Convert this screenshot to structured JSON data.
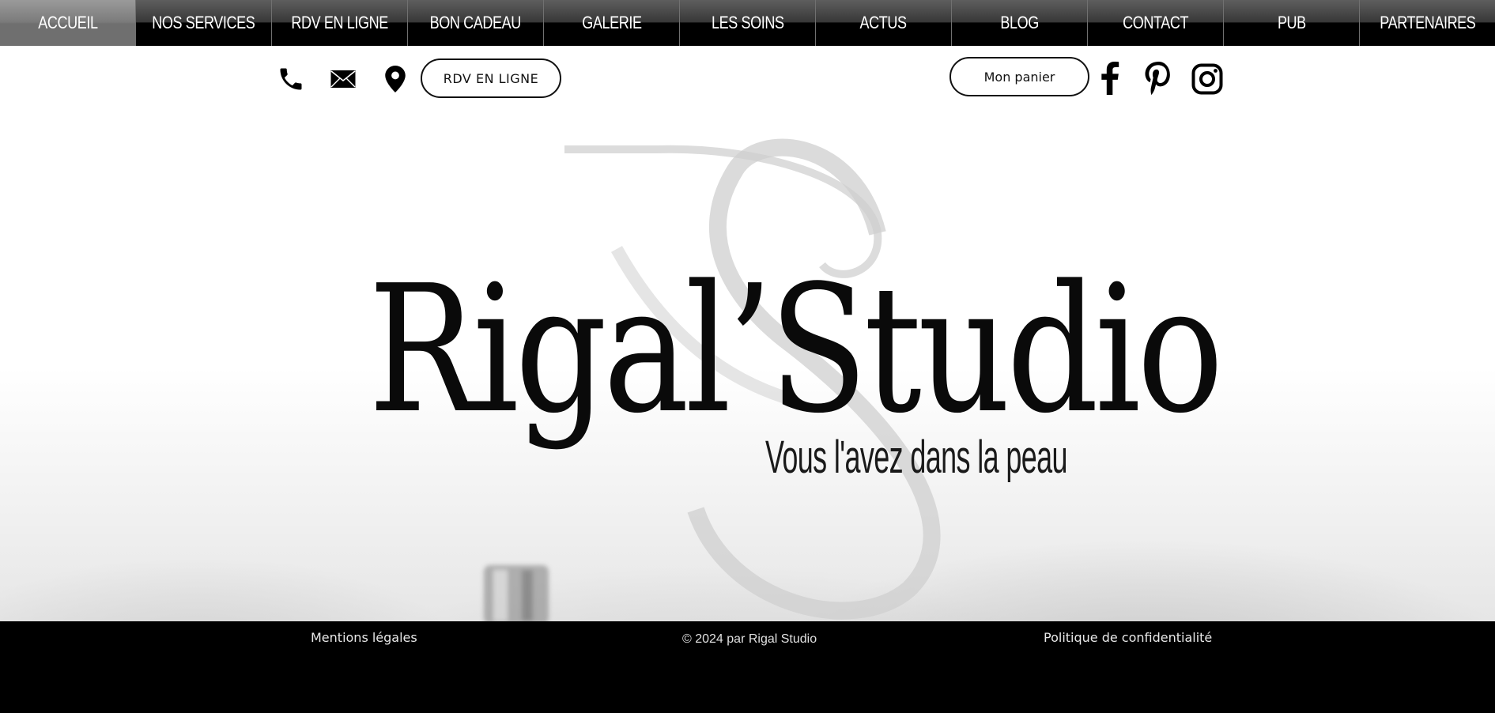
{
  "nav": {
    "items": [
      {
        "label": "ACCUEIL",
        "active": true
      },
      {
        "label": "NOS SERVICES"
      },
      {
        "label": "RDV EN LIGNE"
      },
      {
        "label": "BON CADEAU"
      },
      {
        "label": "GALERIE"
      },
      {
        "label": "LES SOINS"
      },
      {
        "label": "ACTUS"
      },
      {
        "label": "BLOG"
      },
      {
        "label": "CONTACT"
      },
      {
        "label": "PUB"
      },
      {
        "label": "PARTENAIRES"
      }
    ]
  },
  "header": {
    "contact_icons": [
      "phone-icon",
      "envelope-icon",
      "map-pin-icon"
    ],
    "rdv_button": "RDV EN LIGNE",
    "cart_button": "Mon panier",
    "social_icons": [
      "facebook-icon",
      "pinterest-icon",
      "instagram-icon"
    ]
  },
  "hero": {
    "logo_text": "Rigal’Studio",
    "tagline": "Vous l'avez dans la peau"
  },
  "footer": {
    "legal": "Mentions légales",
    "copyright": "© 2024 par Rigal Studio",
    "privacy": "Politique de confidentialité"
  },
  "colors": {
    "nav_background": "#000000",
    "nav_active": "#7b7b7b",
    "footer_background": "#000000",
    "text_dark": "#0a0a0a"
  }
}
